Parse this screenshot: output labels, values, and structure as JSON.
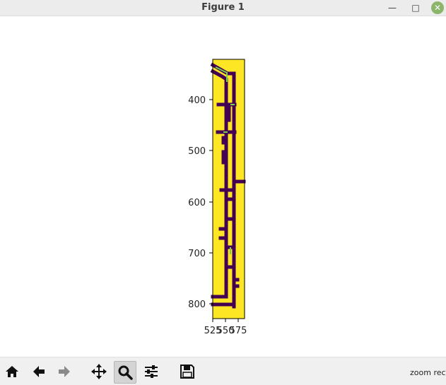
{
  "window": {
    "title": "Figure 1",
    "minimize": "—",
    "maximize": "□",
    "close": "✕"
  },
  "plot": {
    "colors": {
      "background": "#fde725",
      "wall": "#440154",
      "path": "#7ad151"
    },
    "y_ticks": [
      "400",
      "500",
      "600",
      "700",
      "800"
    ],
    "x_ticks": [
      "525",
      "550",
      "575"
    ]
  },
  "toolbar": {
    "buttons": [
      {
        "name": "home-button",
        "icon": "home-icon"
      },
      {
        "name": "back-button",
        "icon": "arrow-left-icon"
      },
      {
        "name": "forward-button",
        "icon": "arrow-right-icon"
      },
      {
        "name": "pan-button",
        "icon": "move-icon"
      },
      {
        "name": "zoom-button",
        "icon": "magnifier-icon"
      },
      {
        "name": "configure-subplots-button",
        "icon": "sliders-icon"
      },
      {
        "name": "save-button",
        "icon": "floppy-icon"
      }
    ],
    "status": "zoom rect"
  }
}
